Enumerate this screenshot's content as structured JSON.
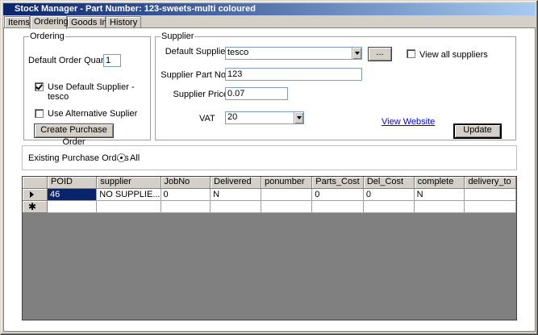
{
  "window": {
    "title": "Stock Manager -  Part Number: 123-sweets-multi coloured"
  },
  "tabs": [
    {
      "label": "Items"
    },
    {
      "label": "Ordering"
    },
    {
      "label": "Goods In"
    },
    {
      "label": "History"
    }
  ],
  "ordering": {
    "legend": "Ordering",
    "default_qty_label": "Default Order Quantity",
    "default_qty_value": "1",
    "use_default_supplier_label": "Use Default Supplier -",
    "use_default_supplier_label2": "tesco",
    "use_default_supplier_checked": true,
    "use_alt_supplier_label": "Use Alternative Suplier",
    "use_alt_supplier_checked": false,
    "create_po_button": "Create Purchase Order"
  },
  "supplier": {
    "legend": "Supplier",
    "default_supplier_label": "Default Supplier",
    "default_supplier_value": "tesco",
    "browse_button": "...",
    "view_all_label": "View all suppliers",
    "view_all_checked": false,
    "part_no_label": "Supplier Part No:",
    "part_no_value": "123",
    "price_label": "Supplier Price",
    "price_value": "0.07",
    "vat_label": "VAT",
    "vat_value": "20",
    "website_link": "View Website",
    "update_button": "Update"
  },
  "existing": {
    "label": "Existing Purchase Orders",
    "radio_label": "All",
    "radio_checked": true
  },
  "grid": {
    "columns": [
      "POID",
      "supplier",
      "JobNo",
      "Delivered",
      "ponumber",
      "Parts_Cost",
      "Del_Cost",
      "complete",
      "delivery_to"
    ],
    "rows": [
      [
        "46",
        "NO SUPPLIE...",
        "0",
        "N",
        "",
        "0",
        "0",
        "N",
        ""
      ]
    ]
  }
}
